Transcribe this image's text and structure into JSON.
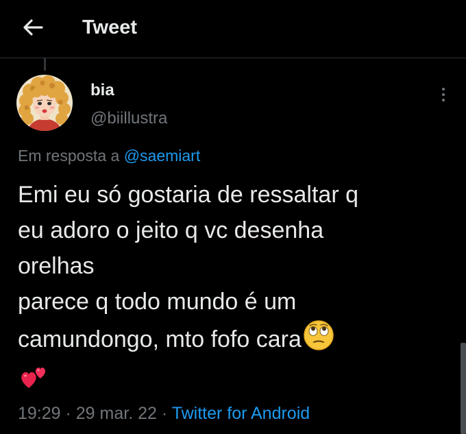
{
  "header": {
    "title": "Tweet",
    "back_icon": "arrow-left-icon"
  },
  "author": {
    "display_name": "bia",
    "handle": "@biillustra",
    "avatar_icon": "avatar-illustration"
  },
  "reply": {
    "prefix": "Em resposta a ",
    "mention": "@saemiart"
  },
  "tweet": {
    "text": "Emi eu só gostaria de ressaltar q\neu adoro o jeito q vc desenha\norelhas\nparece q todo mundo é um\ncamundongo, mto fofo cara",
    "emoji_1": "eye-roll-emoji",
    "emoji_2": "two-hearts-emoji"
  },
  "meta": {
    "time": "19:29",
    "sep1": " · ",
    "date": "29 mar. 22",
    "sep2": " · ",
    "source": "Twitter for Android"
  },
  "colors": {
    "background": "#000000",
    "text": "#e7e9ea",
    "secondary": "#71767b",
    "accent": "#1d9bf0"
  }
}
